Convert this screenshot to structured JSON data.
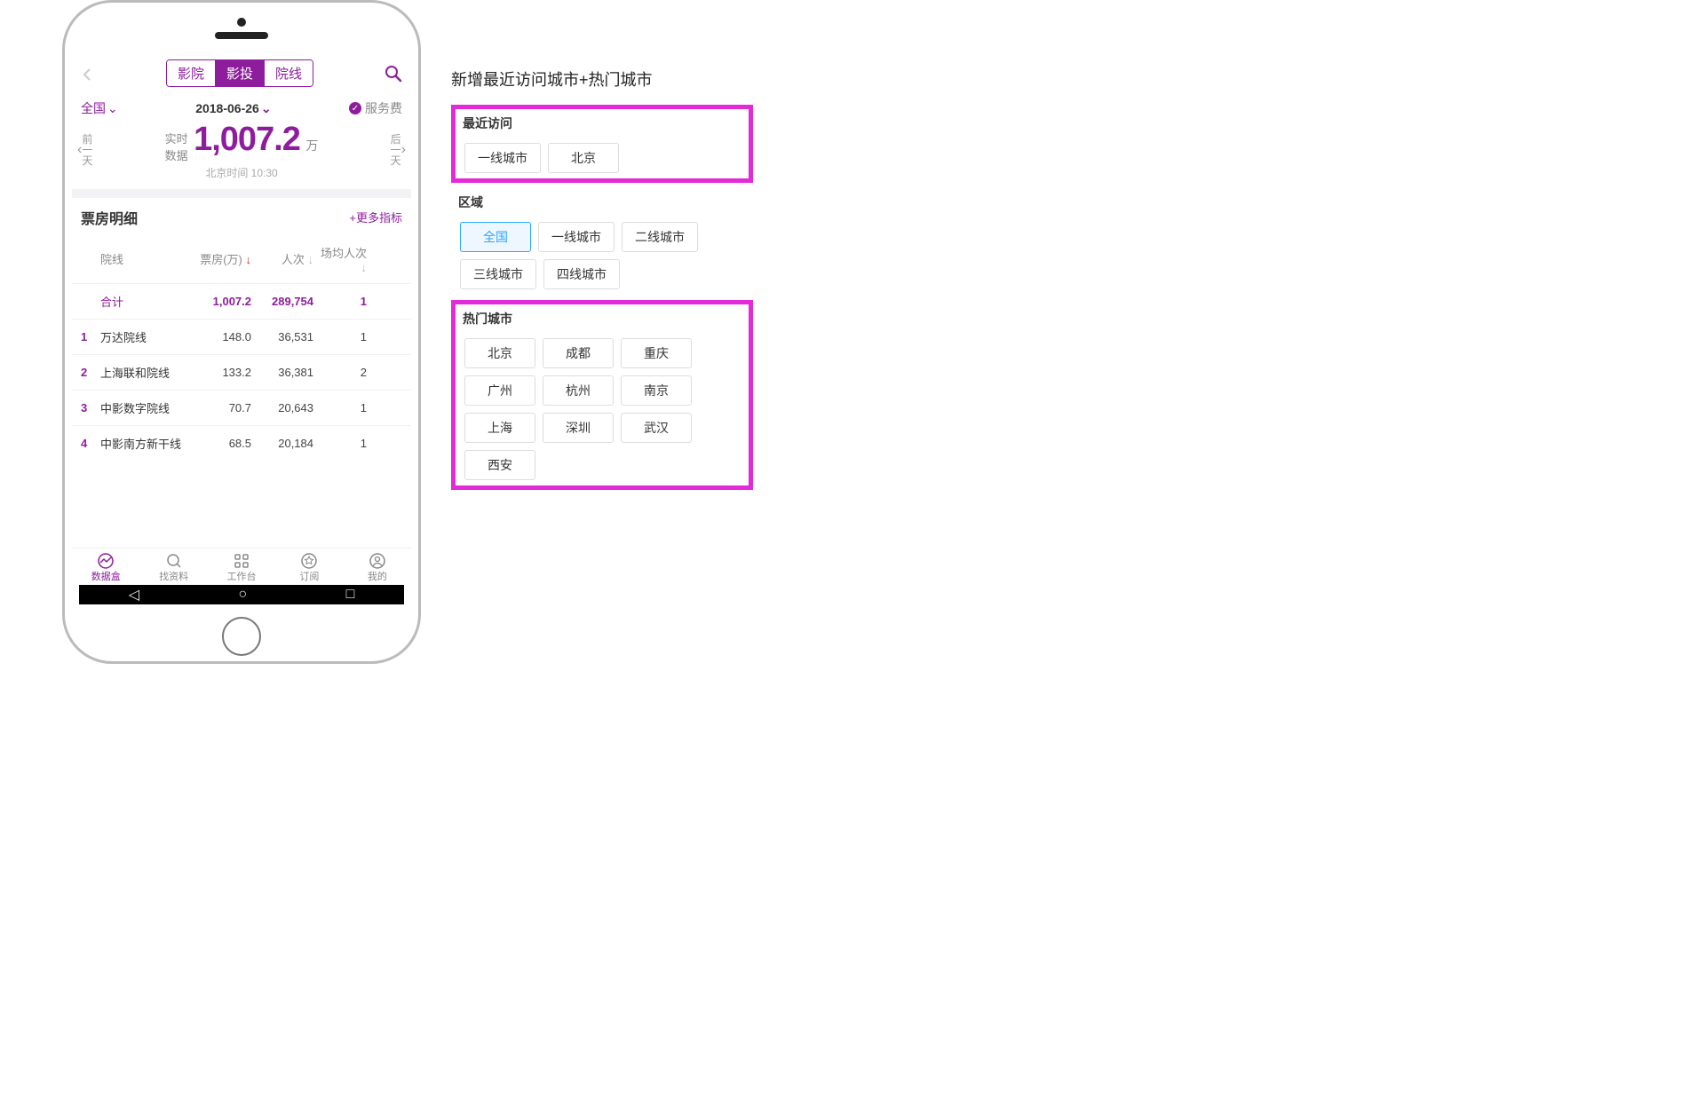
{
  "header": {
    "tabs": [
      "影院",
      "影投",
      "院线"
    ],
    "active_tab": 1
  },
  "filters": {
    "region_label": "全国",
    "date": "2018-06-26",
    "fee_label": "服务费"
  },
  "hero": {
    "prev_label_1": "前",
    "prev_label_2": "一",
    "prev_label_3": "天",
    "next_label_1": "后",
    "next_label_2": "一",
    "next_label_3": "天",
    "realtime_label": "实时\n数据",
    "big_value": "1,007.2",
    "big_unit": "万",
    "time_label": "北京时间 10:30"
  },
  "table": {
    "section_title": "票房明细",
    "more_label": "+更多指标",
    "columns": {
      "name": "院线",
      "box": "票房(万)",
      "attendance": "人次",
      "avg": "场均人次"
    },
    "total_row": {
      "name": "合计",
      "box": "1,007.2",
      "att": "289,754",
      "avg": "1"
    },
    "rows": [
      {
        "rank": "1",
        "name": "万达院线",
        "box": "148.0",
        "att": "36,531",
        "avg": "1"
      },
      {
        "rank": "2",
        "name": "上海联和院线",
        "box": "133.2",
        "att": "36,381",
        "avg": "2"
      },
      {
        "rank": "3",
        "name": "中影数字院线",
        "box": "70.7",
        "att": "20,643",
        "avg": "1"
      },
      {
        "rank": "4",
        "name": "中影南方新干线",
        "box": "68.5",
        "att": "20,184",
        "avg": "1"
      }
    ]
  },
  "bottom_nav": [
    {
      "label": "数据盒",
      "icon": "chart"
    },
    {
      "label": "找资料",
      "icon": "search"
    },
    {
      "label": "工作台",
      "icon": "grid"
    },
    {
      "label": "订阅",
      "icon": "star"
    },
    {
      "label": "我的",
      "icon": "user"
    }
  ],
  "right": {
    "note": "新增最近访问城市+热门城市",
    "sections": [
      {
        "title": "最近访问",
        "highlight": true,
        "items": [
          {
            "label": "一线城市"
          },
          {
            "label": "北京"
          }
        ]
      },
      {
        "title": "区域",
        "highlight": false,
        "items": [
          {
            "label": "全国",
            "active": true
          },
          {
            "label": "一线城市"
          },
          {
            "label": "二线城市"
          },
          {
            "label": "三线城市"
          },
          {
            "label": "四线城市"
          }
        ]
      },
      {
        "title": "热门城市",
        "highlight": true,
        "items": [
          {
            "label": "北京"
          },
          {
            "label": "成都"
          },
          {
            "label": "重庆"
          },
          {
            "label": "广州"
          },
          {
            "label": "杭州"
          },
          {
            "label": "南京"
          },
          {
            "label": "上海"
          },
          {
            "label": "深圳"
          },
          {
            "label": "武汉"
          },
          {
            "label": "西安"
          }
        ]
      }
    ]
  }
}
